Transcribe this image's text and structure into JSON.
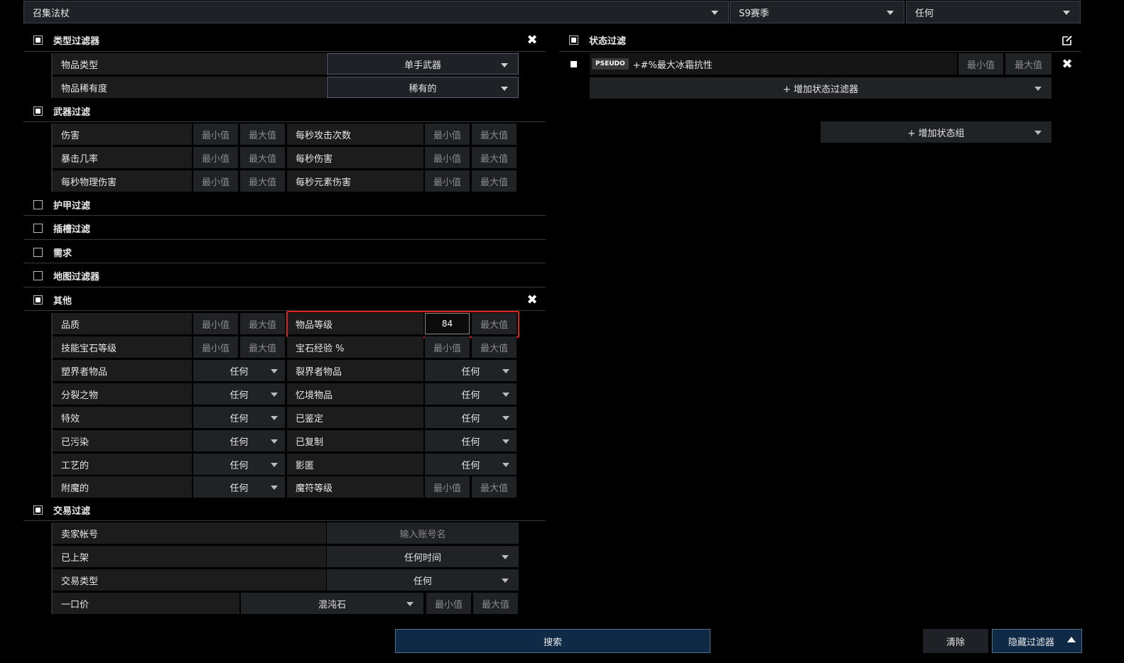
{
  "top": {
    "search_item": "召集法杖",
    "league": "S9赛季",
    "status": "任何"
  },
  "type_filter": {
    "title": "类型过滤器",
    "rows": [
      {
        "label": "物品类型",
        "value": "单手武器"
      },
      {
        "label": "物品稀有度",
        "value": "稀有的"
      }
    ]
  },
  "weapon_filter": {
    "title": "武器过滤",
    "rows": [
      {
        "left": "伤害",
        "right": "每秒攻击次数"
      },
      {
        "left": "暴击几率",
        "right": "每秒伤害"
      },
      {
        "left": "每秒物理伤害",
        "right": "每秒元素伤害"
      }
    ]
  },
  "collapsed": [
    "护甲过滤",
    "插槽过滤",
    "需求",
    "地图过滤器"
  ],
  "misc": {
    "title": "其他",
    "minmax_rows": [
      {
        "left": "品质",
        "right": "物品等级",
        "right_min_value": "84"
      },
      {
        "left": "技能宝石等级",
        "right": "宝石经验 %"
      }
    ],
    "dropdown_rows": [
      {
        "left": "塑界者物品",
        "left_val": "任何",
        "right": "裂界者物品",
        "right_val": "任何"
      },
      {
        "left": "分裂之物",
        "left_val": "任何",
        "right": "忆境物品",
        "right_val": "任何"
      },
      {
        "left": "特效",
        "left_val": "任何",
        "right": "已鉴定",
        "right_val": "任何"
      },
      {
        "left": "已污染",
        "left_val": "任何",
        "right": "已复制",
        "right_val": "任何"
      },
      {
        "left": "工艺的",
        "left_val": "任何",
        "right": "影匿",
        "right_val": "任何"
      }
    ],
    "last_row": {
      "left": "附魔的",
      "left_val": "任何",
      "right": "魔符等级"
    }
  },
  "trade_filter": {
    "title": "交易过滤",
    "seller_label": "卖家帐号",
    "seller_placeholder": "输入账号名",
    "listed_label": "已上架",
    "listed_value": "任何时间",
    "sale_type_label": "交易类型",
    "sale_type_value": "任何",
    "buyout_label": "一口价",
    "buyout_currency": "混沌石"
  },
  "common": {
    "min": "最小值",
    "max": "最大值"
  },
  "stat_filter": {
    "title": "状态过滤",
    "stat": {
      "tag": "PSEUDO",
      "text": "+#%最大冰霜抗性"
    },
    "add_stat": "+ 增加状态过滤器",
    "add_group": "+ 增加状态组"
  },
  "footer": {
    "search": "搜索",
    "clear": "清除",
    "hide": "隐藏过滤器"
  },
  "colors": {
    "highlight": "#d9221e",
    "primary": "#0f2a46",
    "border": "#56606e"
  }
}
